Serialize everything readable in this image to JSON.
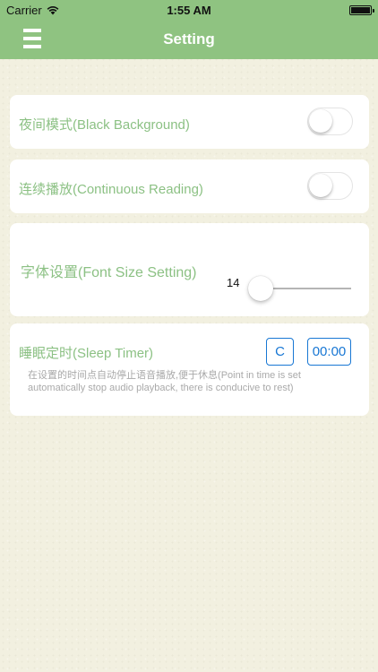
{
  "status_bar": {
    "carrier": "Carrier",
    "time": "1:55 AM",
    "battery_level": 1.0
  },
  "nav": {
    "title": "Setting",
    "menu_icon": "hamburger-menu-icon"
  },
  "settings": {
    "night_mode": {
      "label": "夜间模式(Black Background)",
      "enabled": false
    },
    "continuous_play": {
      "label": "连续播放(Continuous Reading)",
      "enabled": false
    },
    "font_size": {
      "label": "字体设置(Font Size Setting)",
      "value": "14",
      "slider_fraction": 0.0
    },
    "sleep_timer": {
      "label": "睡眠定时(Sleep Timer)",
      "cancel_label": "C",
      "time_label": "00:00",
      "description": "在设置的时间点自动停止语音播放,便于休息(Point in time is set automatically stop audio playback, there is conducive to rest)"
    }
  },
  "colors": {
    "bar_green": "#8fc381",
    "label_green": "#8cc184",
    "button_blue": "#1877d4",
    "page_background": "#f2f0e0"
  }
}
